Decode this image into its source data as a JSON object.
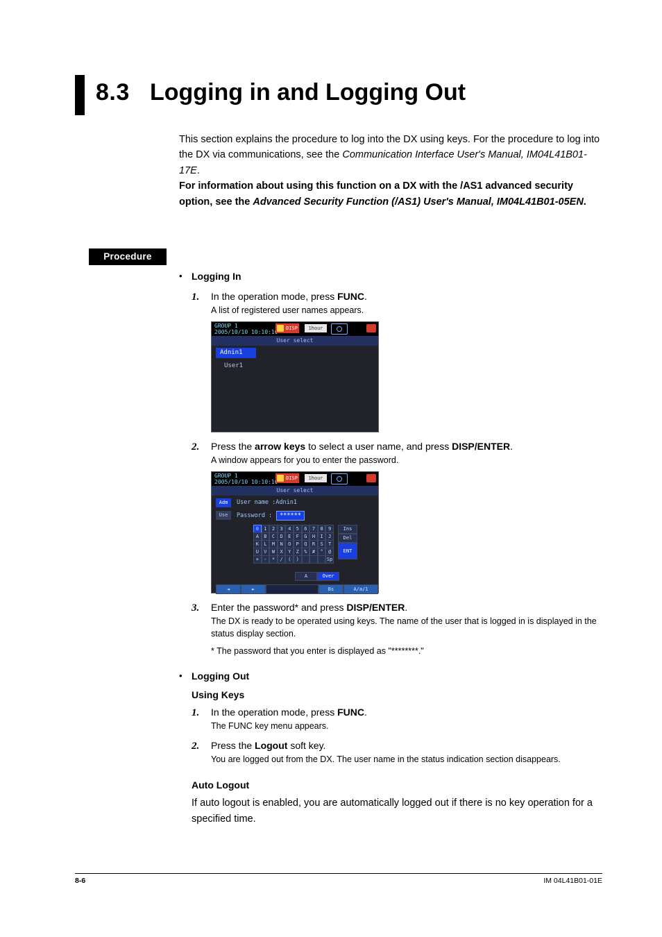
{
  "heading": {
    "number": "8.3",
    "title": "Logging in and Logging Out"
  },
  "intro": {
    "p1a": "This section explains the procedure to log into the DX using keys. For the procedure to log into the DX via communications, see the ",
    "p1_em": "Communication Interface User's Manual, IM04L41B01-17E",
    "p1b": ".",
    "p2a": "For information about using this function on a DX with the /AS1 advanced security option, see the ",
    "p2_em": "Advanced Security Function (/AS1) User's Manual, IM04L41B01-05EN",
    "p2b": "."
  },
  "procedure_label": "Procedure",
  "login": {
    "title": "Logging In",
    "s1_a": "In the operation mode, press ",
    "s1_b": "FUNC",
    "s1_c": ".",
    "s1_small": "A list of registered user names appears.",
    "s2_a": "Press the ",
    "s2_b": "arrow keys",
    "s2_c": " to select a user name, and press ",
    "s2_d": "DISP/ENTER",
    "s2_e": ".",
    "s2_small": "A window appears for you to enter the password.",
    "s3_a": "Enter the password* and press ",
    "s3_b": "DISP/ENTER",
    "s3_c": ".",
    "s3_small": "The DX is ready to be operated using keys. The name of the user that is logged in is displayed in the status display section.",
    "s3_note": "* The password that you enter is displayed as \"********.\""
  },
  "logout": {
    "title": "Logging Out",
    "sub1": "Using Keys",
    "s1_a": "In the operation mode, press ",
    "s1_b": "FUNC",
    "s1_c": ".",
    "s1_small": "The FUNC key menu appears.",
    "s2_a": "Press the ",
    "s2_b": "Logout",
    "s2_c": " soft key.",
    "s2_small": "You are logged out from the DX. The user name in the status indication section disappears.",
    "sub2": "Auto Logout",
    "auto_p": "If auto logout is enabled, you are automatically logged out if there is no key operation for a specified time."
  },
  "screen1": {
    "group": "GROUP 1",
    "timestamp": "2005/10/10 10:10:10",
    "disp": "DISP",
    "span": "1hour",
    "bar": "User select",
    "admin": "Adnin1",
    "user": "User1"
  },
  "screen2": {
    "group": "GROUP 1",
    "timestamp": "2005/10/10 10:10:10",
    "disp": "DISP",
    "span": "1hour",
    "bar": "User select",
    "adm": "Adm",
    "use": "Use",
    "un_label": "User  name :",
    "un_value": "Adnin1",
    "pw_label": "Password   :",
    "pw_value": "******",
    "row0": [
      "0",
      "1",
      "2",
      "3",
      "4",
      "5",
      "6",
      "7",
      "8",
      "9"
    ],
    "row1": [
      "A",
      "B",
      "C",
      "D",
      "E",
      "F",
      "G",
      "H",
      "I",
      "J"
    ],
    "row2": [
      "K",
      "L",
      "M",
      "N",
      "O",
      "P",
      "Q",
      "R",
      "S",
      "T"
    ],
    "row3": [
      "U",
      "V",
      "W",
      "X",
      "Y",
      "Z",
      "%",
      "#",
      "°",
      "@"
    ],
    "row4": [
      "+",
      "-",
      "*",
      "/",
      "(",
      ")",
      "",
      "",
      "",
      "Sp"
    ],
    "ins": "Ins",
    "del": "Del",
    "ent": "ENT",
    "A": "A",
    "over": "Over",
    "bs": "Bs",
    "aa": "A/a/1",
    "left": "◄",
    "right": "►"
  },
  "footer": {
    "page": "8-6",
    "doc": "IM 04L41B01-01E"
  }
}
